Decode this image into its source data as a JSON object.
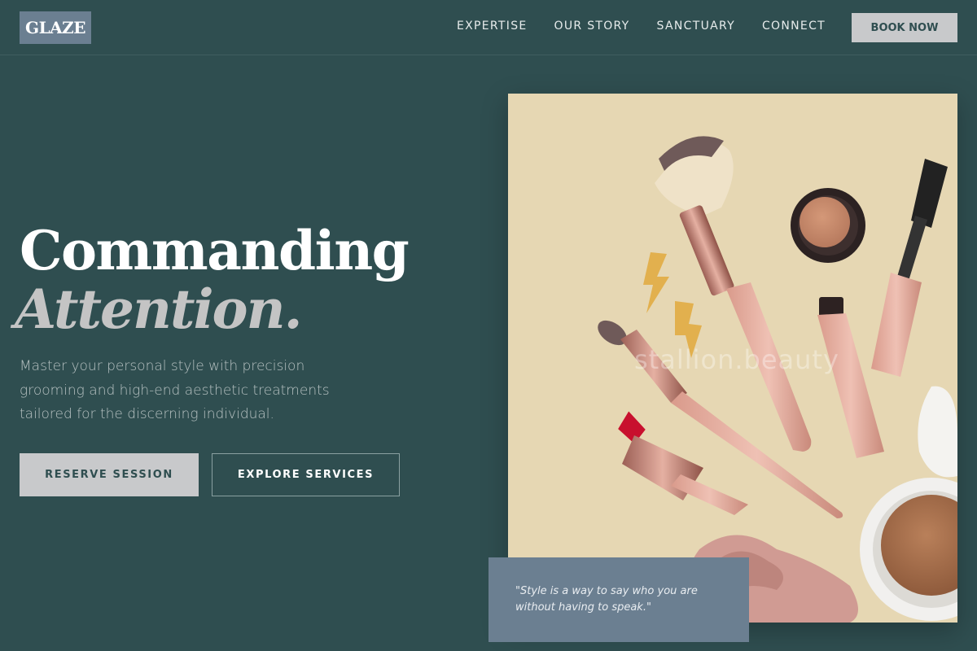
{
  "header": {
    "logo": "GLAZE",
    "nav": [
      {
        "label": "EXPERTISE"
      },
      {
        "label": "OUR STORY"
      },
      {
        "label": "SANCTUARY"
      },
      {
        "label": "CONNECT"
      }
    ],
    "cta": "BOOK NOW"
  },
  "hero": {
    "headline_line1": "Commanding",
    "headline_line2": "Attention.",
    "description": "Master your personal style with precision grooming and high-end aesthetic treatments tailored for the discerning individual.",
    "primary_button": "RESERVE SESSION",
    "secondary_button": "EXPLORE SERVICES"
  },
  "image": {
    "watermark": "stallion.beauty"
  },
  "quote": {
    "text": "\"Style is a way to say who you are without having to speak.\""
  },
  "colors": {
    "background": "#2f4e50",
    "accent_light": "#c8c9cb",
    "card": "#6b7f91",
    "image_bg": "#e6d7b3"
  }
}
